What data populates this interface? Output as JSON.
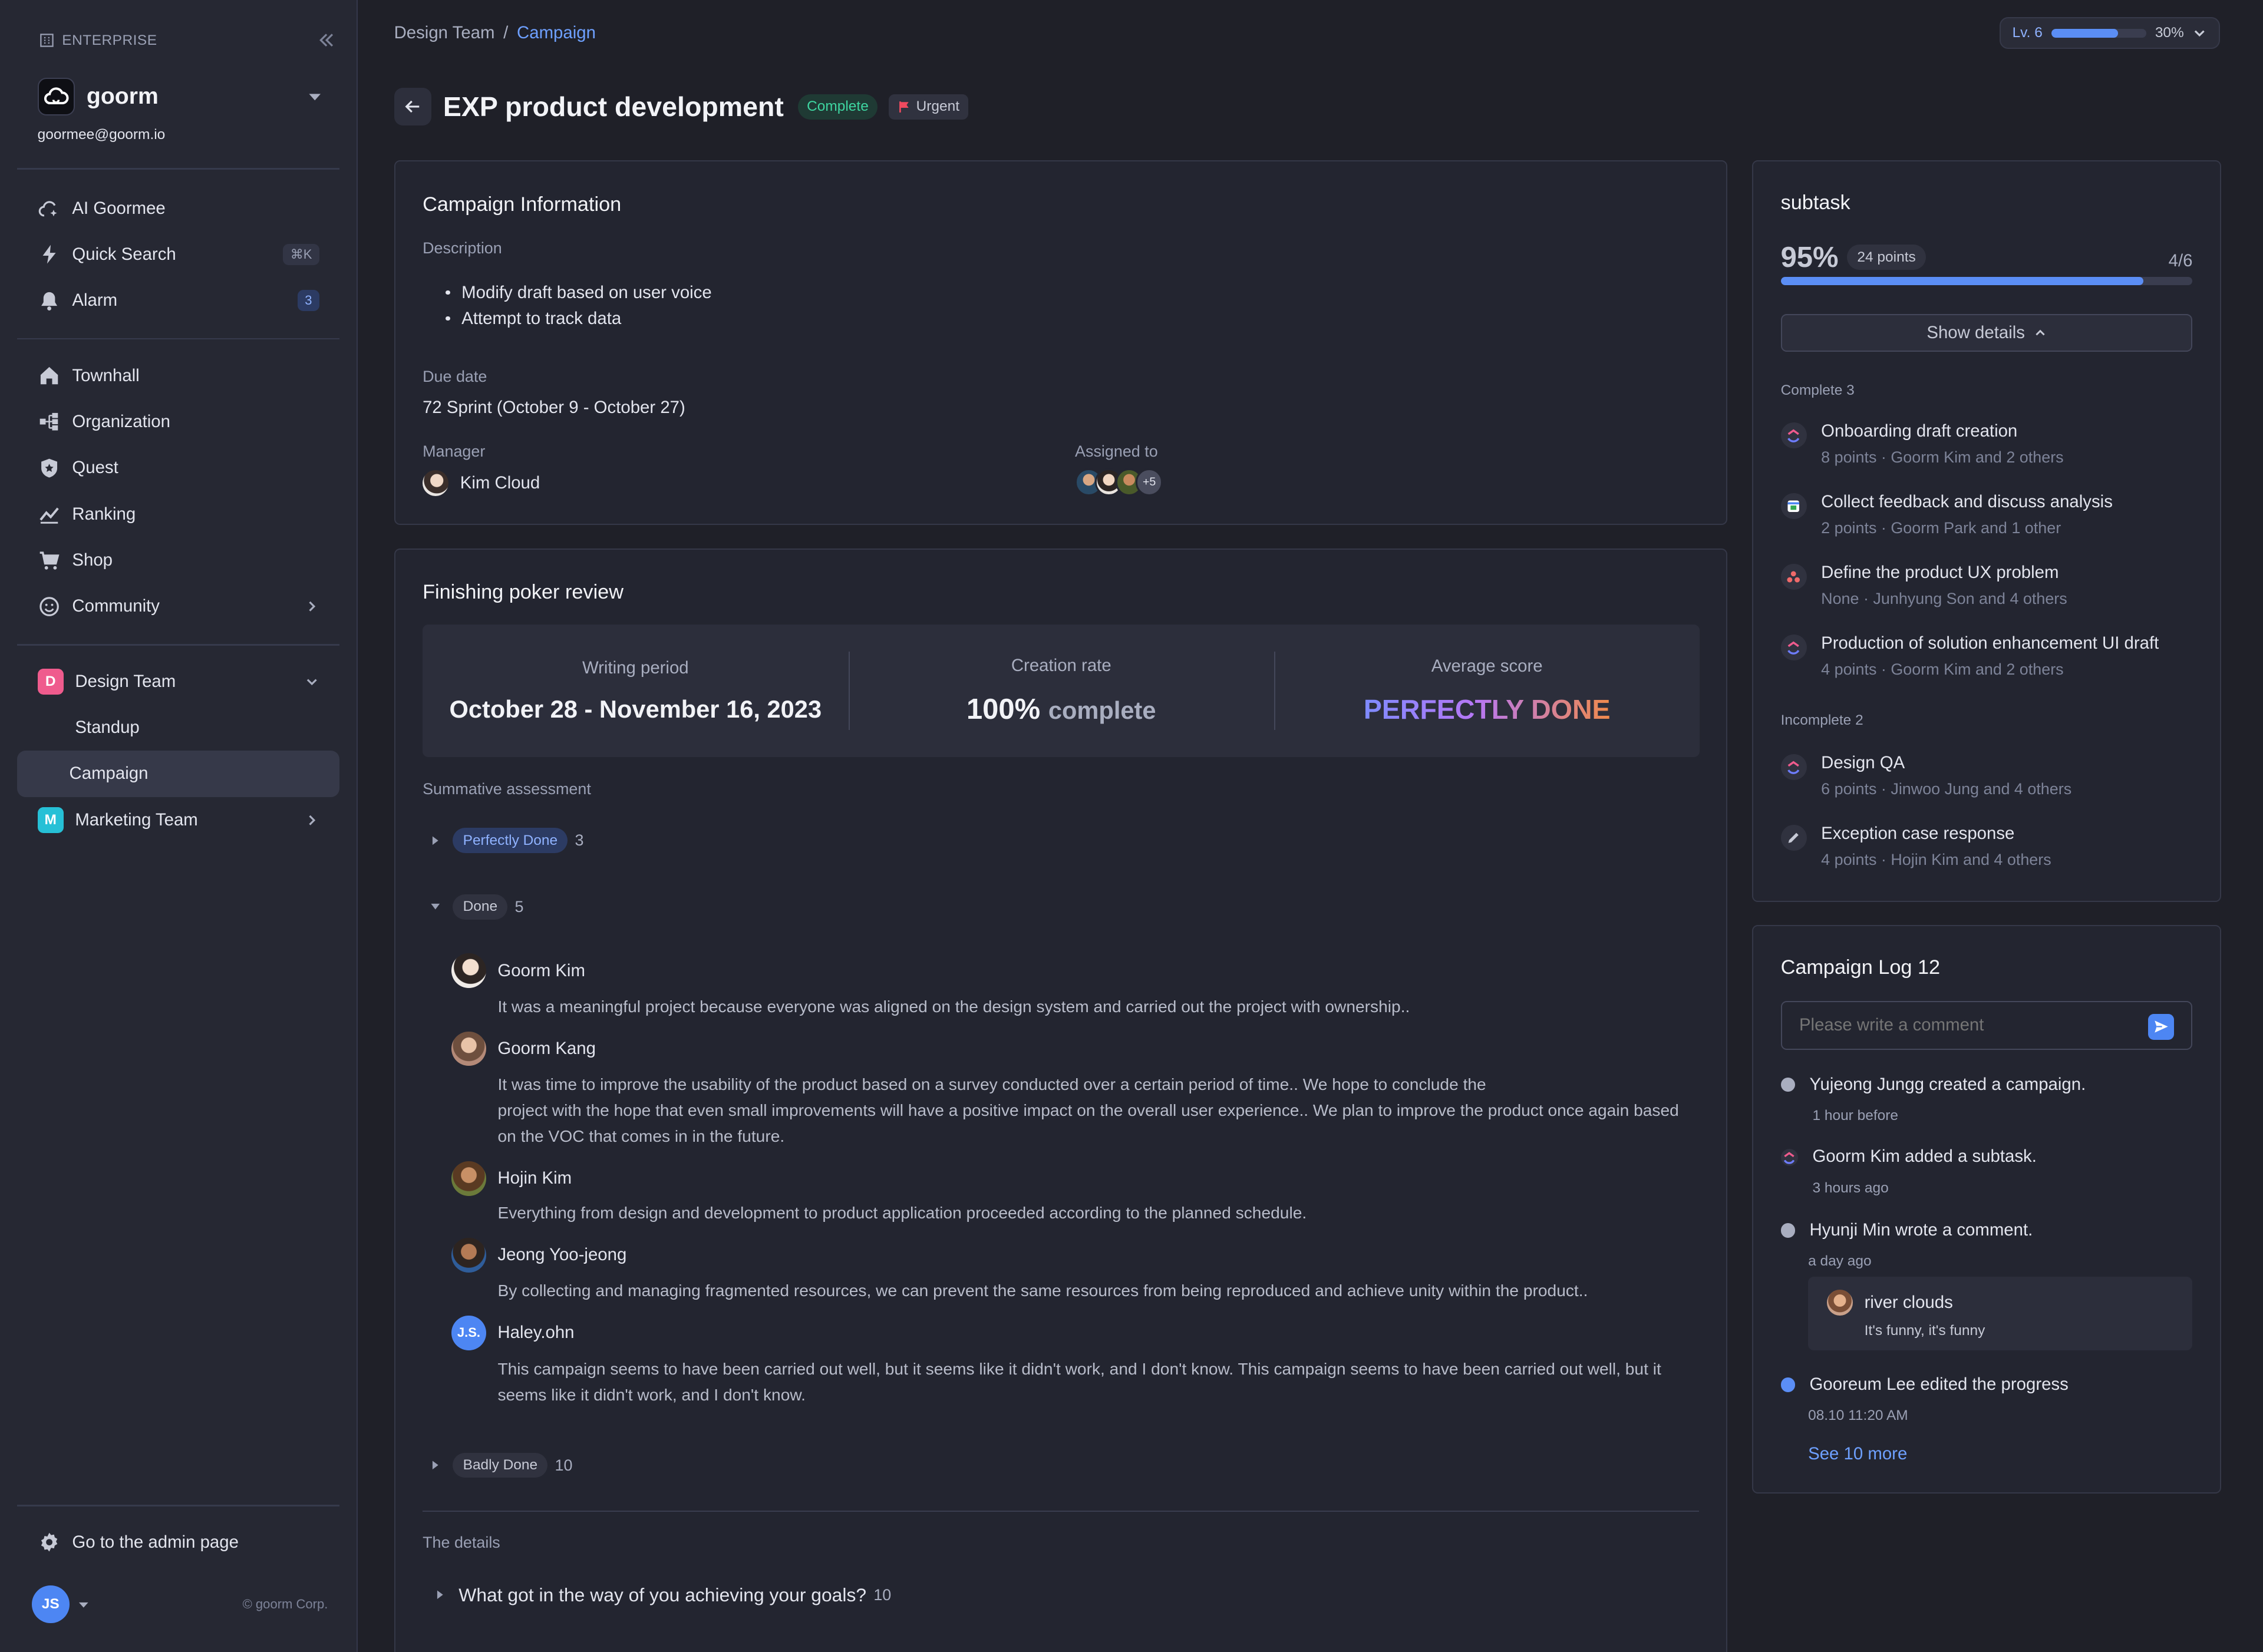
{
  "sidebar": {
    "enterprise_label": "ENTERPRISE",
    "brand": "goorm",
    "email": "goormee@goorm.io",
    "nav_top": [
      {
        "label": "AI Goormee",
        "icon": "cloud-sparkle-icon"
      },
      {
        "label": "Quick Search",
        "icon": "lightning-icon",
        "shortcut": "⌘K"
      },
      {
        "label": "Alarm",
        "icon": "bell-icon",
        "badge": "3"
      }
    ],
    "nav_main": [
      {
        "label": "Townhall",
        "icon": "home-icon"
      },
      {
        "label": "Organization",
        "icon": "org-chart-icon"
      },
      {
        "label": "Quest",
        "icon": "shield-star-icon"
      },
      {
        "label": "Ranking",
        "icon": "ranking-icon"
      },
      {
        "label": "Shop",
        "icon": "cart-icon"
      },
      {
        "label": "Community",
        "icon": "smile-icon"
      }
    ],
    "teams": [
      {
        "initial": "D",
        "label": "Design Team",
        "color": "#ef5b8d",
        "children": [
          "Standup",
          "Campaign"
        ]
      },
      {
        "initial": "M",
        "label": "Marketing Team",
        "color": "#26c0d6"
      }
    ],
    "admin_label": "Go to the admin page",
    "user_initials": "JS",
    "corp": "© goorm Corp."
  },
  "breadcrumb": {
    "parent": "Design Team",
    "sep": "/",
    "current": "Campaign"
  },
  "level": {
    "label": "Lv. 6",
    "progress": 0.7,
    "percent": "30%"
  },
  "page": {
    "title": "EXP product development",
    "status": "Complete",
    "priority": "Urgent"
  },
  "info": {
    "heading": "Campaign Information",
    "description_label": "Description",
    "bullets": [
      "Modify draft based on user voice",
      "Attempt to track data"
    ],
    "due_label": "Due date",
    "due_value": "72 Sprint (October 9 - October 27)",
    "manager_label": "Manager",
    "manager_name": "Kim Cloud",
    "assigned_label": "Assigned to",
    "assigned_more": "+5"
  },
  "review": {
    "heading": "Finishing poker review",
    "stats": {
      "period_label": "Writing period",
      "period_value": "October 28 - November 16, 2023",
      "rate_label": "Creation rate",
      "rate_value": "100%",
      "rate_suffix": "complete",
      "avg_label": "Average score",
      "avg_value": "PERFECTLY DONE"
    },
    "summative_label": "Summative assessment",
    "groups": [
      {
        "tag": "Perfectly Done",
        "count": "3"
      },
      {
        "tag": "Done",
        "count": "5"
      },
      {
        "tag": "Badly Done",
        "count": "10"
      }
    ],
    "reviews": [
      {
        "name": "Goorm Kim",
        "text": "It was a meaningful project because everyone was aligned on the design system and carried out the project with ownership.."
      },
      {
        "name": "Goorm Kang",
        "text1": "It was time to improve the usability of the product based on a survey conducted over a certain period of time.. We hope to conclude the",
        "text2": "project with the hope that even small improvements will have a positive impact on the overall user experience.. We plan to improve the product once again based on the VOC that comes in in the future."
      },
      {
        "name": "Hojin Kim",
        "text": "Everything from design and development to product application proceeded according to the planned schedule."
      },
      {
        "name": "Jeong Yoo-jeong",
        "text": "By collecting and managing fragmented resources, we can prevent the same resources from being reproduced and achieve unity within the product.."
      },
      {
        "name": "Haley.ohn",
        "initials": "J.S.",
        "text": "This campaign seems to have been carried out well, but it seems like it didn't work, and I don't know. This campaign seems to have been carried out well, but it seems like it didn't work, and I don't know."
      }
    ],
    "details_label": "The details",
    "question": "What got in the way of you achieving your goals?",
    "question_count": "10"
  },
  "subtask": {
    "heading": "subtask",
    "percent": "95%",
    "points": "24 points",
    "fraction": "4/6",
    "progress": 0.88,
    "show_details": "Show details",
    "complete_label": "Complete 3",
    "incomplete_label": "Incomplete 2",
    "complete": [
      {
        "title": "Onboarding draft creation",
        "meta": "8 points · Goorm Kim and 2 others",
        "icon": "clickup-icon"
      },
      {
        "title": "Collect feedback and discuss analysis",
        "meta": "2 points · Goorm Park and 1 other",
        "icon": "calendar-app-icon"
      },
      {
        "title": "Define the product UX problem",
        "meta": "None · Junhyung Son and 4 others",
        "icon": "asana-icon"
      },
      {
        "title": "Production of solution enhancement UI draft",
        "meta": "4 points · Goorm Kim and 2 others",
        "icon": "clickup-icon"
      }
    ],
    "incomplete": [
      {
        "title": "Design QA",
        "meta": "6 points · Jinwoo Jung and 4 others",
        "icon": "clickup-icon"
      },
      {
        "title": "Exception case response",
        "meta": "4 points · Hojin Kim and 4 others",
        "icon": "pencil-icon"
      }
    ]
  },
  "log": {
    "heading": "Campaign Log 12",
    "placeholder": "Please write a comment",
    "entries": [
      {
        "text": "Yujeong Jungg created a campaign.",
        "time": "1 hour before"
      },
      {
        "text": "Goorm Kim added a subtask.",
        "time": "3 hours ago"
      },
      {
        "text": "Hyunji Min wrote a comment.",
        "time": "a day ago",
        "comment_author": "river clouds",
        "comment_text": "It's funny, it's funny"
      },
      {
        "text": "Gooreum Lee edited the progress",
        "time": "08.10 11:20 AM"
      }
    ],
    "see_more": "See 10 more"
  }
}
